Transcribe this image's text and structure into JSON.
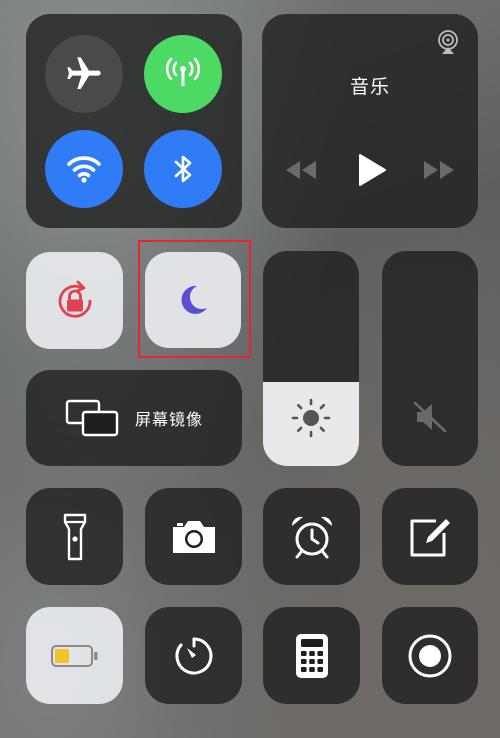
{
  "music": {
    "title": "音乐"
  },
  "screen_mirroring": {
    "label": "屏幕镜像"
  },
  "brightness": {
    "level": 0.39
  },
  "volume": {
    "level": 0.0
  },
  "colors": {
    "accent_green": "#4cd964",
    "accent_blue": "#2f7cf6",
    "rotation_lock_red": "#e0424f",
    "moon_purple": "#5a4fd1",
    "battery_yellow": "#f5c02a",
    "highlight_red": "#e8262b"
  }
}
